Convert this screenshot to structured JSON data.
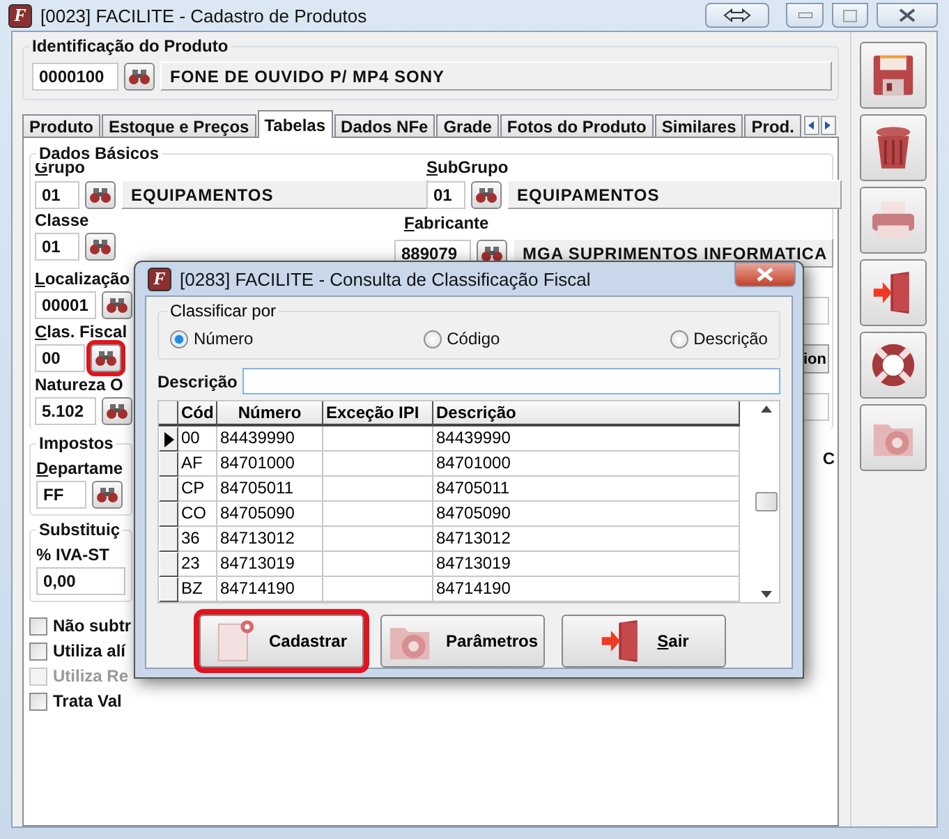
{
  "window": {
    "title": "[0023] FACILITE - Cadastro de Produtos",
    "logo": "F"
  },
  "product": {
    "label": "Identificação do Produto",
    "code": "0000100",
    "description": "FONE DE OUVIDO P/ MP4 SONY"
  },
  "tabs": [
    {
      "label": "Produto",
      "selected": false
    },
    {
      "label": "Estoque e Preços",
      "selected": false
    },
    {
      "label": "Tabelas",
      "selected": true
    },
    {
      "label": "Dados NFe",
      "selected": false
    },
    {
      "label": "Grade",
      "selected": false
    },
    {
      "label": "Fotos do Produto",
      "selected": false
    },
    {
      "label": "Similares",
      "selected": false
    },
    {
      "label": "Prod.",
      "selected": false
    }
  ],
  "basic_data": {
    "label": "Dados Básicos",
    "grupo": {
      "label": "Grupo",
      "accel": true,
      "code": "01",
      "description": "EQUIPAMENTOS"
    },
    "subgrupo": {
      "label": "SubGrupo",
      "accel": true,
      "code": "01",
      "description": "EQUIPAMENTOS"
    },
    "classe": {
      "label": "Classe",
      "accel": false,
      "code": "01"
    },
    "fabricante": {
      "label": "Fabricante",
      "accel": true,
      "code": "889079",
      "description": "MGA SUPRIMENTOS INFORMATICA"
    },
    "localizacao": {
      "label": "Localização",
      "accel": true,
      "code": "00001",
      "highlighted": false
    },
    "clas_fiscal": {
      "label": "Clas. Fiscal",
      "accel": true,
      "code": "00",
      "highlighted": true
    },
    "natureza": {
      "label": "Natureza O",
      "accel": false,
      "code": "5.102",
      "highlighted": false
    }
  },
  "right_button": "ion",
  "right_label": "C",
  "impostos": {
    "label": "Impostos",
    "field_label": "Departame",
    "code": "FF"
  },
  "substituicao": {
    "label": "Substituiç",
    "field_label": "% IVA-ST",
    "value": "0,00"
  },
  "checkboxes": [
    {
      "label": "Não subtr",
      "checked": false,
      "disabled": false
    },
    {
      "label": "Utiliza alí",
      "checked": false,
      "disabled": false
    },
    {
      "label": "Utiliza Re",
      "checked": false,
      "disabled": true
    },
    {
      "label": "Trata Val",
      "checked": false,
      "disabled": false
    }
  ],
  "dialog": {
    "title": "[0283] FACILITE - Consulta de Classificação Fiscal",
    "logo": "F",
    "sort_label": "Classificar por",
    "sort_options": [
      {
        "label": "Número",
        "selected": true
      },
      {
        "label": "Código",
        "selected": false
      },
      {
        "label": "Descrição",
        "selected": false
      }
    ],
    "search_label": "Descrição",
    "columns": [
      "Cód",
      "Número",
      "Exceção IPI",
      "Descrição"
    ],
    "rows": [
      {
        "cells": [
          "00",
          "84439990",
          "",
          "84439990"
        ],
        "selected": true
      },
      {
        "cells": [
          "AF",
          "84701000",
          "",
          "84701000"
        ],
        "selected": false
      },
      {
        "cells": [
          "CP",
          "84705011",
          "",
          "84705011"
        ],
        "selected": false
      },
      {
        "cells": [
          "CO",
          "84705090",
          "",
          "84705090"
        ],
        "selected": false
      },
      {
        "cells": [
          "36",
          "84713012",
          "",
          "84713012"
        ],
        "selected": false
      },
      {
        "cells": [
          "23",
          "84713019",
          "",
          "84713019"
        ],
        "selected": false
      },
      {
        "cells": [
          "BZ",
          "84714190",
          "",
          "84714190"
        ],
        "selected": false
      }
    ],
    "buttons": [
      {
        "kind": "new",
        "label": "Cadastrar",
        "accel": false,
        "highlighted": true
      },
      {
        "kind": "settings",
        "label": "Parâmetros",
        "accel": false,
        "highlighted": false
      },
      {
        "kind": "exit",
        "label": "Sair",
        "accel": true,
        "highlighted": false
      }
    ]
  }
}
